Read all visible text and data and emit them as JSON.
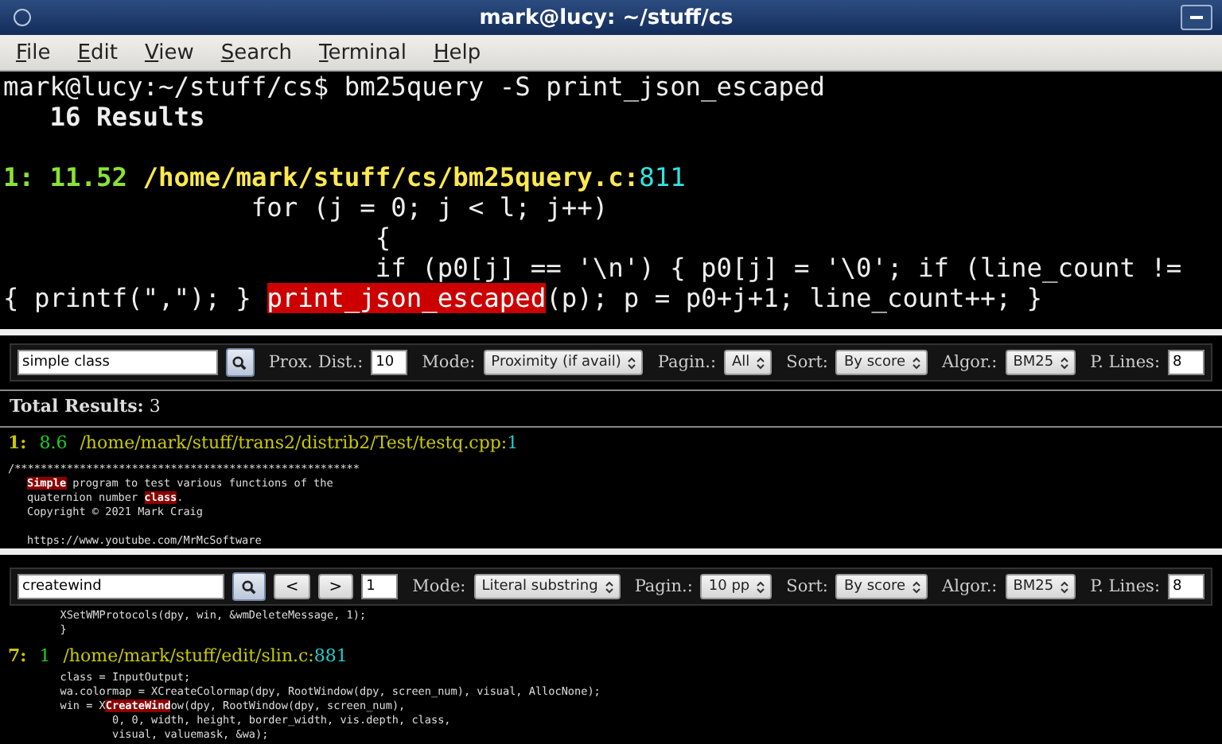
{
  "window": {
    "title": "mark@lucy: ~/stuff/cs"
  },
  "menu": [
    "File",
    "Edit",
    "View",
    "Search",
    "Terminal",
    "Help"
  ],
  "terminal": {
    "lines": [
      {
        "kind": "plain",
        "segments": [
          {
            "text": "mark@lucy:~/stuff/cs$ bm25query -S print_json_escaped",
            "match": false
          }
        ]
      },
      {
        "kind": "bold",
        "segments": [
          {
            "text": "   16 Results",
            "match": false
          }
        ]
      },
      {
        "kind": "blank"
      },
      {
        "kind": "result",
        "rank": "1:",
        "score": "11.52",
        "path": "/home/mark/stuff/cs/bm25query.c:",
        "line": "811"
      },
      {
        "kind": "plain",
        "segments": [
          {
            "text": "                for (j = 0; j < l; j++)",
            "match": false
          }
        ]
      },
      {
        "kind": "plain",
        "segments": [
          {
            "text": "                        {",
            "match": false
          }
        ]
      },
      {
        "kind": "plain",
        "segments": [
          {
            "text": "                        if (p0[j] == '\\n') { p0[j] = '\\0'; if (line_count !=",
            "match": false
          }
        ]
      },
      {
        "kind": "plain",
        "segments": [
          {
            "text": "{ printf(\",\"); } ",
            "match": false
          },
          {
            "text": "print_json_escaped",
            "match": true
          },
          {
            "text": "(p); p = p0+j+1; line_count++; }",
            "match": false
          }
        ]
      }
    ]
  },
  "panes": [
    {
      "query": "simple class",
      "controls": [
        {
          "kind": "number",
          "label": "Prox. Dist.:",
          "value": "10"
        },
        {
          "kind": "select",
          "label": "Mode:",
          "value": "Proximity (if avail)"
        },
        {
          "kind": "select",
          "label": "Pagin.:",
          "value": "All"
        },
        {
          "kind": "select",
          "label": "Sort:",
          "value": "By score"
        },
        {
          "kind": "select",
          "label": "Algor.:",
          "value": "BM25"
        },
        {
          "kind": "number",
          "label": "P. Lines:",
          "value": "8"
        }
      ],
      "total": {
        "label": "Total Results:",
        "value": "3"
      },
      "result": {
        "rank": "1:",
        "score": "8.6",
        "path": "/home/mark/stuff/trans2/distrib2/Test/testq.cpp:",
        "line": "1"
      },
      "code": [
        {
          "kind": "text",
          "segments": [
            {
              "text": "/*****************************************************",
              "match": false
            }
          ]
        },
        {
          "kind": "indented",
          "segments": [
            {
              "text": "Simple",
              "match": true
            },
            {
              "text": " program to test various functions of the",
              "match": false
            }
          ]
        },
        {
          "kind": "indented",
          "segments": [
            {
              "text": "quaternion number ",
              "match": false
            },
            {
              "text": "class",
              "match": true
            },
            {
              "text": ".",
              "match": false
            }
          ]
        },
        {
          "kind": "indented",
          "segments": [
            {
              "text": "Copyright © 2021 Mark Craig",
              "match": false
            }
          ]
        },
        {
          "kind": "blank"
        },
        {
          "kind": "indented",
          "segments": [
            {
              "text": "https://www.youtube.com/MrMcSoftware",
              "match": false
            }
          ]
        }
      ]
    },
    {
      "query": "createwind",
      "controls": [
        {
          "kind": "nav",
          "value": "<"
        },
        {
          "kind": "nav",
          "value": ">"
        },
        {
          "kind": "number",
          "value": "1"
        },
        {
          "kind": "select",
          "label": "Mode:",
          "value": "Literal substring"
        },
        {
          "kind": "select",
          "label": "Pagin.:",
          "value": "10 pp"
        },
        {
          "kind": "select",
          "label": "Sort:",
          "value": "By score"
        },
        {
          "kind": "select",
          "label": "Algor.:",
          "value": "BM25"
        },
        {
          "kind": "number",
          "label": "P. Lines:",
          "value": "8"
        }
      ],
      "before": [
        {
          "kind": "text",
          "segments": [
            {
              "text": "        XSetWMProtocols(dpy, win, &wmDeleteMessage, 1);",
              "match": false
            }
          ]
        },
        {
          "kind": "text",
          "segments": [
            {
              "text": "        }",
              "match": false
            }
          ]
        }
      ],
      "result": {
        "rank": "7:",
        "score": "1",
        "path": "/home/mark/stuff/edit/slin.c:",
        "line": "881"
      },
      "code": [
        {
          "kind": "text",
          "segments": [
            {
              "text": "        class = InputOutput;",
              "match": false
            }
          ]
        },
        {
          "kind": "text",
          "segments": [
            {
              "text": "        wa.colormap = XCreateColormap(dpy, RootWindow(dpy, screen_num), visual, AllocNone);",
              "match": false
            }
          ]
        },
        {
          "kind": "text",
          "segments": [
            {
              "text": "        win = X",
              "match": false
            },
            {
              "text": "CreateWind",
              "match": true
            },
            {
              "text": "ow(dpy, RootWindow(dpy, screen_num),",
              "match": false
            }
          ]
        },
        {
          "kind": "text",
          "segments": [
            {
              "text": "                0, 0, width, height, border_width, vis.depth, class,",
              "match": false
            }
          ]
        },
        {
          "kind": "text",
          "segments": [
            {
              "text": "                visual, valuemask, &wa);",
              "match": false
            }
          ]
        }
      ]
    }
  ]
}
